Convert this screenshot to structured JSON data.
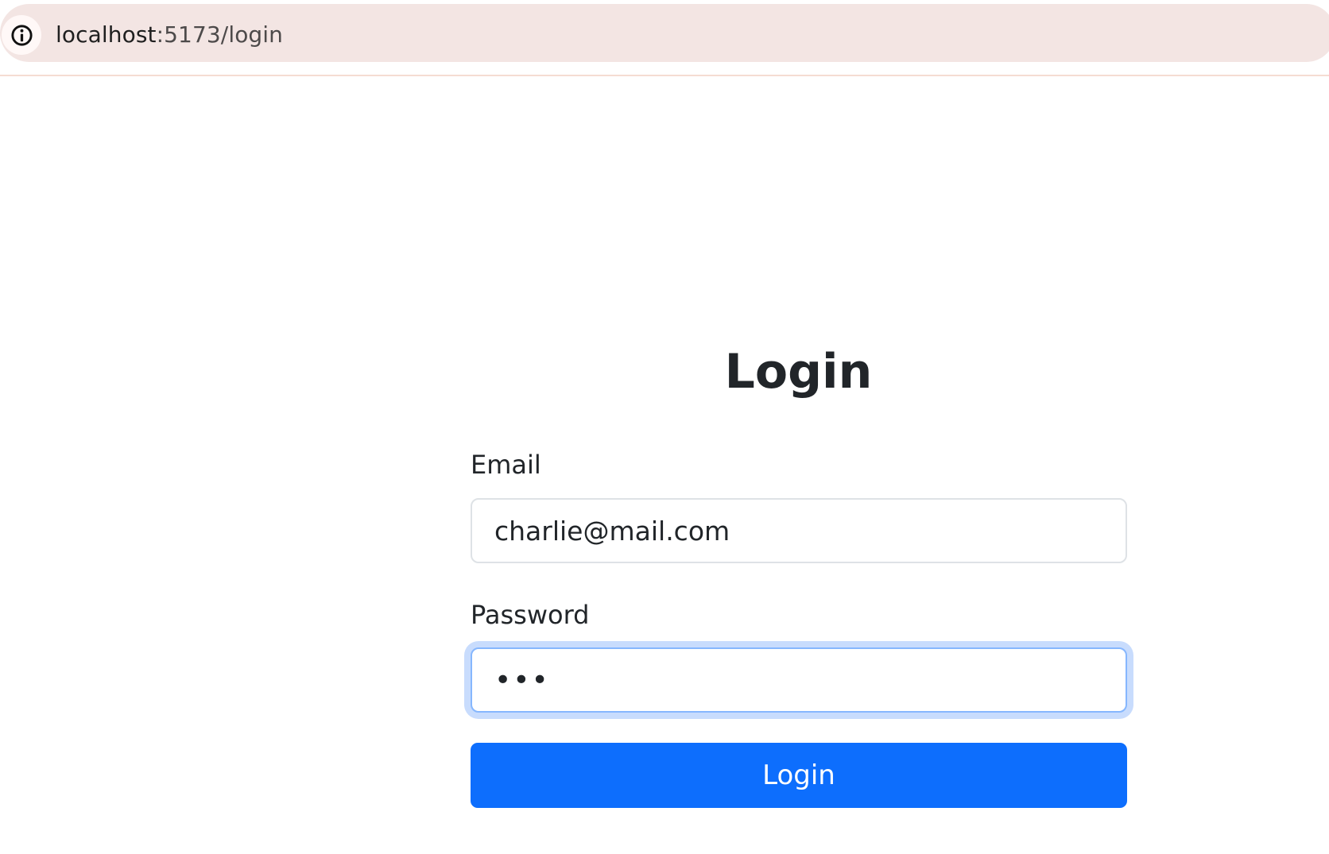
{
  "browser": {
    "url_host": "localhost",
    "url_path": ":5173/login",
    "site_info_icon": "info-icon"
  },
  "login": {
    "title": "Login",
    "email_label": "Email",
    "email_value": "charlie@mail.com",
    "password_label": "Password",
    "password_value": "abc",
    "button_label": "Login"
  },
  "colors": {
    "address_bar": "#f3e5e3",
    "primary_button": "#0d6efd",
    "focus_ring": "#c8dcfd",
    "text": "#212529"
  }
}
